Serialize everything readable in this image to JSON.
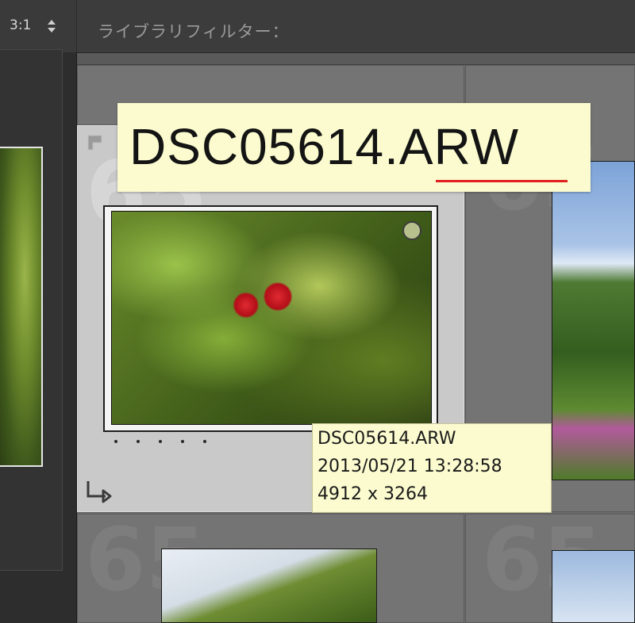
{
  "toolbar": {
    "zoom_ratio": "3:1",
    "filter_title": "ライブラリフィルター："
  },
  "grid": {
    "ghost_numbers": [
      "65",
      "65",
      "65",
      "65"
    ],
    "selected": {
      "filename": "DSC05614.ARW",
      "rating_dots": 5,
      "tooltip": {
        "filename": "DSC05614.ARW",
        "datetime": "2013/05/21 13:28:58",
        "dimensions": "4912 x 3264"
      }
    }
  },
  "annotation": {
    "filename_large": "DSC05614.ARW",
    "underline_color": "#e0201f"
  },
  "colors": {
    "callout_bg": "#fbfbcf",
    "selected_cell_bg": "#c9c9c9"
  }
}
